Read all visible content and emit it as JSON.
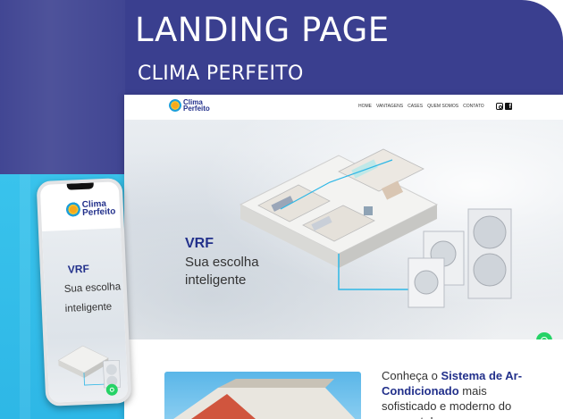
{
  "hero": {
    "title": "LANDING PAGE",
    "subtitle": "CLIMA PERFEITO"
  },
  "brand": {
    "line1": "Clima",
    "line2": "Perfeito",
    "primary_color": "#22308b",
    "accent_color": "#2eb7e6",
    "background_color": "#3a3f8f"
  },
  "desktop": {
    "nav": {
      "items": [
        "Home",
        "Vantagens",
        "Cases",
        "Quem somos",
        "Contato"
      ]
    },
    "social_icons": [
      "instagram-icon",
      "facebook-icon"
    ],
    "hero": {
      "heading": "VRF",
      "tagline_line1": "Sua escolha",
      "tagline_line2": "inteligente"
    },
    "section": {
      "intro": "Conheça o ",
      "highlight": "Sistema de Ar-Condicionado",
      "rest": " mais sofisticado e moderno do momento!"
    },
    "chat_icon": "whatsapp-icon"
  },
  "mobile": {
    "menu_icon": "☰",
    "hero": {
      "heading": "VRF",
      "tagline_line1": "Sua escolha",
      "tagline_line2": "inteligente"
    },
    "chat_icon": "whatsapp-icon"
  }
}
